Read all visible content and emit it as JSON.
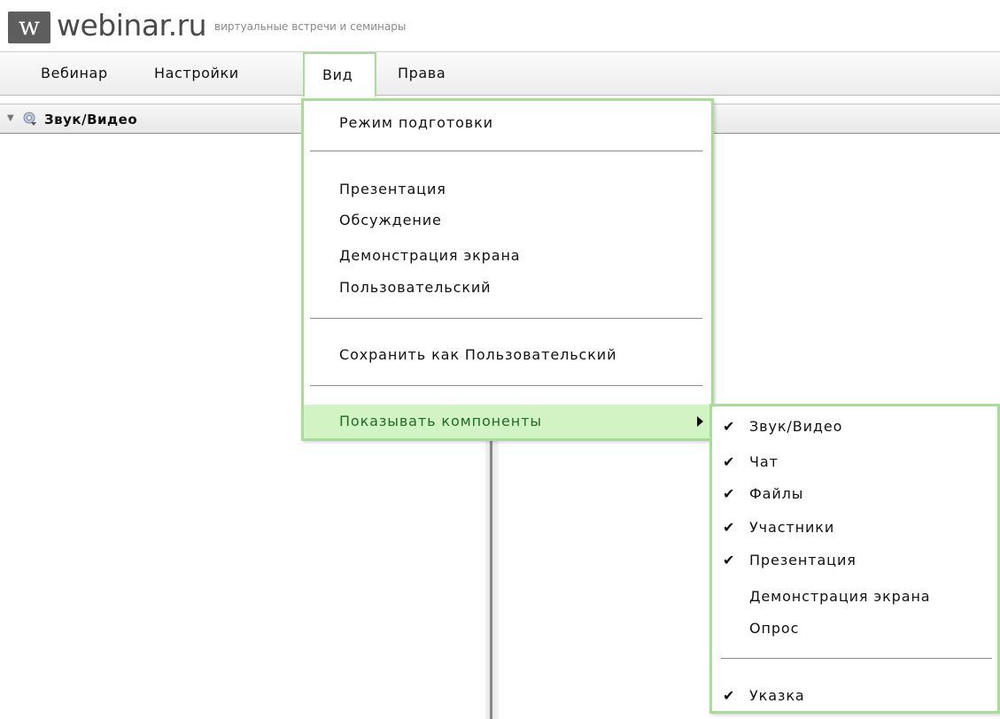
{
  "header": {
    "logo_letter": "w",
    "brand": "webinar.ru",
    "tagline": "виртуальные встречи и семинары"
  },
  "menubar": {
    "items": [
      "Вебинар",
      "Настройки",
      "Вид",
      "Права"
    ],
    "active": "Вид"
  },
  "panel": {
    "title": "Звук/Видео"
  },
  "view_menu": {
    "items": [
      "Режим подготовки",
      "Презентация",
      "Обсуждение",
      "Демонстрация экрана",
      "Пользовательский",
      "Сохранить как Пользовательский",
      "Показывать компоненты"
    ],
    "highlighted": "Показывать компоненты"
  },
  "components_submenu": {
    "items": [
      {
        "label": "Звук/Видео",
        "checked": true
      },
      {
        "label": "Чат",
        "checked": true
      },
      {
        "label": "Файлы",
        "checked": true
      },
      {
        "label": "Участники",
        "checked": true
      },
      {
        "label": "Презентация",
        "checked": true
      },
      {
        "label": "Демонстрация экрана",
        "checked": false
      },
      {
        "label": "Опрос",
        "checked": false
      },
      {
        "label": "Указка",
        "checked": true
      }
    ],
    "check_glyph": "✔"
  },
  "colors": {
    "menu_accent_border": "#a8dd98",
    "highlight_bg": "#d2f3c4",
    "highlight_text": "#1f6b2a",
    "logo_bg": "#5e5e5e"
  }
}
